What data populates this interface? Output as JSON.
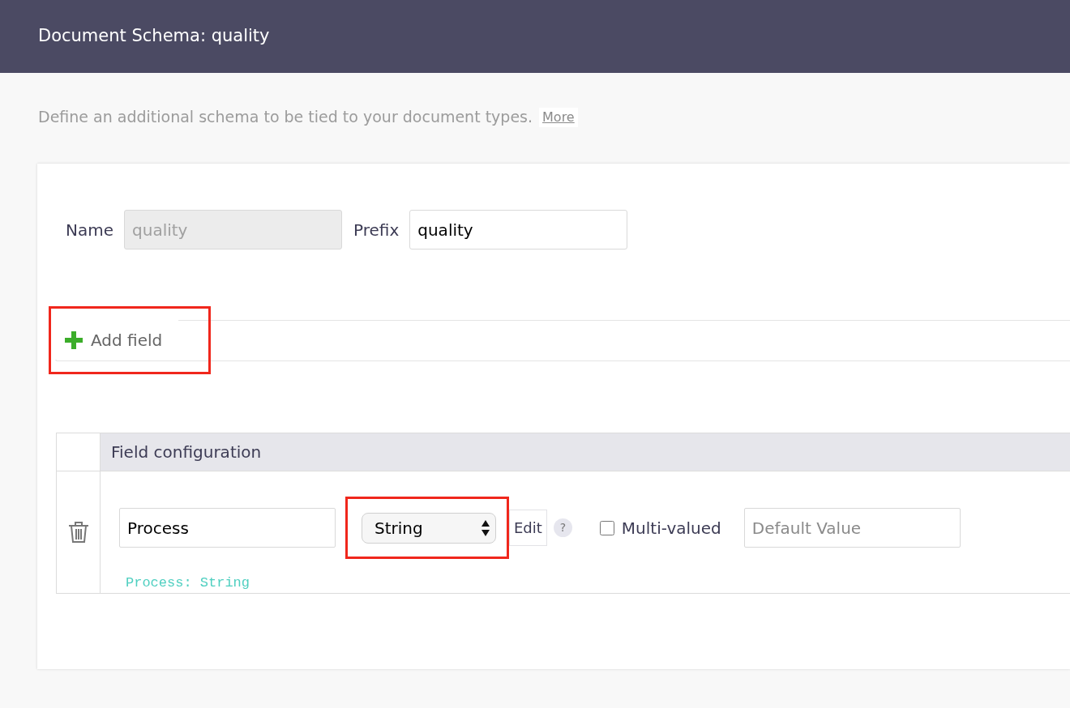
{
  "header": {
    "title": "Document Schema: quality"
  },
  "intro": {
    "text": "Define an additional schema to be tied to your document types.",
    "link": "More"
  },
  "form": {
    "name": {
      "label": "Name",
      "value": "quality",
      "disabled": true
    },
    "prefix": {
      "label": "Prefix",
      "value": "quality",
      "disabled": false
    }
  },
  "add_field": {
    "label": "Add field",
    "highlighted": true
  },
  "table": {
    "columns": [
      "Field configuration"
    ],
    "rows": [
      {
        "name": "Process",
        "type": "String",
        "type_highlighted": true,
        "edit": "Edit",
        "help": "?",
        "multi_valued": {
          "label": "Multi-valued",
          "checked": false
        },
        "default_value": {
          "placeholder": "Default Value"
        },
        "summary": "Process: String"
      }
    ]
  }
}
